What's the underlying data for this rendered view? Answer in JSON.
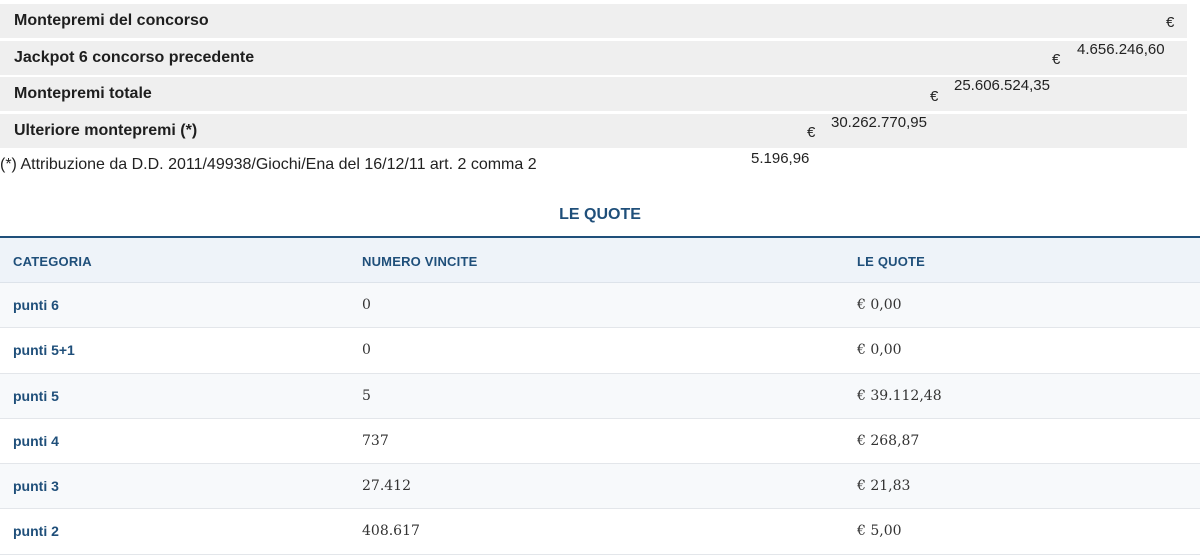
{
  "montepremi": {
    "rows": [
      {
        "label": "Montepremi del concorso",
        "currency": "€"
      },
      {
        "label": "Jackpot 6 concorso precedente",
        "currency": "€",
        "amount": "4.656.246,60"
      },
      {
        "label": "Montepremi totale",
        "currency": "€",
        "amount": "25.606.524,35"
      },
      {
        "label": "Ulteriore montepremi (*)",
        "currency": "€",
        "amount": "30.262.770,95"
      }
    ],
    "extra_amount": "5.196,96",
    "note": "(*) Attribuzione da D.D. 2011/49938/Giochi/Ena del 16/12/11 art. 2 comma 2"
  },
  "quote": {
    "title": "LE QUOTE",
    "headers": [
      "CATEGORIA",
      "NUMERO VINCITE",
      "LE QUOTE"
    ],
    "rows": [
      {
        "categoria": "punti 6",
        "vincite": "0",
        "quota": "€ 0,00"
      },
      {
        "categoria": "punti 5+1",
        "vincite": "0",
        "quota": "€ 0,00"
      },
      {
        "categoria": "punti 5",
        "vincite": "5",
        "quota": "€ 39.112,48"
      },
      {
        "categoria": "punti 4",
        "vincite": "737",
        "quota": "€ 268,87"
      },
      {
        "categoria": "punti 3",
        "vincite": "27.412",
        "quota": "€ 21,83"
      },
      {
        "categoria": "punti 2",
        "vincite": "408.617",
        "quota": "€ 5,00"
      }
    ]
  },
  "colors": {
    "accent": "#1f4f7a",
    "row_bg": "#efefef",
    "header_bg": "#eef3f9"
  }
}
